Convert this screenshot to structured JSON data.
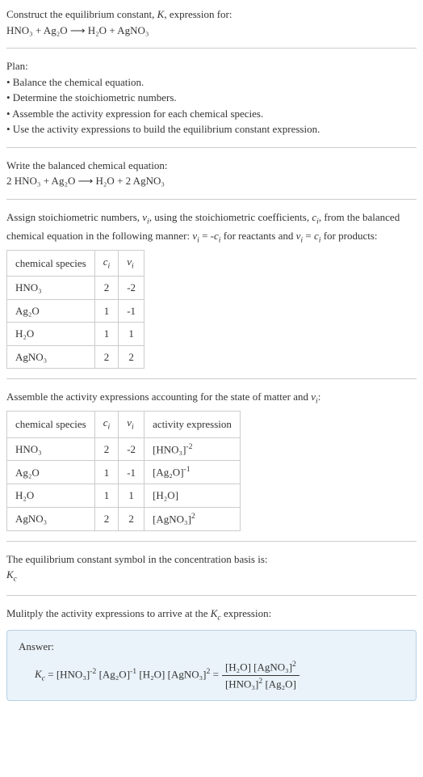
{
  "header": {
    "title_line1": "Construct the equilibrium constant, K, expression for:",
    "equation": "HNO₃ + Ag₂O  ⟶  H₂O + AgNO₃"
  },
  "plan": {
    "title": "Plan:",
    "bullets": [
      "• Balance the chemical equation.",
      "• Determine the stoichiometric numbers.",
      "• Assemble the activity expression for each chemical species.",
      "• Use the activity expressions to build the equilibrium constant expression."
    ]
  },
  "balanced": {
    "title": "Write the balanced chemical equation:",
    "equation": "2 HNO₃ + Ag₂O  ⟶  H₂O + 2 AgNO₃"
  },
  "stoich": {
    "intro1": "Assign stoichiometric numbers, νᵢ, using the stoichiometric coefficients, cᵢ, from the balanced chemical equation in the following manner: νᵢ = -cᵢ for reactants and νᵢ = cᵢ for products:",
    "headers": [
      "chemical species",
      "cᵢ",
      "νᵢ"
    ],
    "rows": [
      {
        "species": "HNO₃",
        "ci": "2",
        "vi": "-2"
      },
      {
        "species": "Ag₂O",
        "ci": "1",
        "vi": "-1"
      },
      {
        "species": "H₂O",
        "ci": "1",
        "vi": "1"
      },
      {
        "species": "AgNO₃",
        "ci": "2",
        "vi": "2"
      }
    ]
  },
  "activity": {
    "intro": "Assemble the activity expressions accounting for the state of matter and νᵢ:",
    "headers": [
      "chemical species",
      "cᵢ",
      "νᵢ",
      "activity expression"
    ],
    "rows": [
      {
        "species": "HNO₃",
        "ci": "2",
        "vi": "-2",
        "expr_base": "[HNO₃]",
        "expr_exp": "-2"
      },
      {
        "species": "Ag₂O",
        "ci": "1",
        "vi": "-1",
        "expr_base": "[Ag₂O]",
        "expr_exp": "-1"
      },
      {
        "species": "H₂O",
        "ci": "1",
        "vi": "1",
        "expr_base": "[H₂O]",
        "expr_exp": ""
      },
      {
        "species": "AgNO₃",
        "ci": "2",
        "vi": "2",
        "expr_base": "[AgNO₃]",
        "expr_exp": "2"
      }
    ]
  },
  "basis": {
    "line1": "The equilibrium constant symbol in the concentration basis is:",
    "symbol": "K꜀"
  },
  "multiply": {
    "line": "Mulitply the activity expressions to arrive at the K꜀ expression:"
  },
  "answer": {
    "label": "Answer:",
    "lhs": "K꜀ = [HNO₃]⁻² [Ag₂O]⁻¹ [H₂O] [AgNO₃]² = ",
    "frac_num": "[H₂O] [AgNO₃]²",
    "frac_den": "[HNO₃]² [Ag₂O]"
  },
  "chart_data": {
    "type": "table",
    "tables": [
      {
        "title": "Stoichiometric numbers",
        "columns": [
          "chemical species",
          "c_i",
          "v_i"
        ],
        "rows": [
          [
            "HNO3",
            2,
            -2
          ],
          [
            "Ag2O",
            1,
            -1
          ],
          [
            "H2O",
            1,
            1
          ],
          [
            "AgNO3",
            2,
            2
          ]
        ]
      },
      {
        "title": "Activity expressions",
        "columns": [
          "chemical species",
          "c_i",
          "v_i",
          "activity expression"
        ],
        "rows": [
          [
            "HNO3",
            2,
            -2,
            "[HNO3]^-2"
          ],
          [
            "Ag2O",
            1,
            -1,
            "[Ag2O]^-1"
          ],
          [
            "H2O",
            1,
            1,
            "[H2O]"
          ],
          [
            "AgNO3",
            2,
            2,
            "[AgNO3]^2"
          ]
        ]
      }
    ]
  }
}
